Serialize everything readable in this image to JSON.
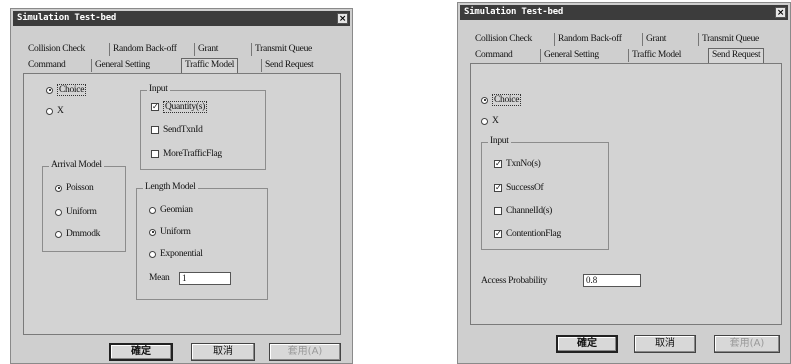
{
  "left_dialog": {
    "title": "Simulation Test-bed",
    "close_glyph": "×",
    "tabs_row1": [
      "Collision Check",
      "Random Back-off",
      "Grant",
      "Transmit Queue"
    ],
    "tabs_row2": [
      "Command",
      "General Setting",
      "Traffic Model",
      "Send Request"
    ],
    "active_tab": "Traffic Model",
    "top_radios": [
      {
        "label": "Choice",
        "checked": true
      },
      {
        "label": "X",
        "checked": false
      }
    ],
    "input_group": {
      "title": "Input",
      "items": [
        {
          "label": "Quantity(s)",
          "checked": true
        },
        {
          "label": "SendTxnId",
          "checked": false
        },
        {
          "label": "MoreTrafficFlag",
          "checked": false
        }
      ]
    },
    "arrival_group": {
      "title": "Arrival Model",
      "items": [
        {
          "label": "Poisson",
          "checked": true
        },
        {
          "label": "Uniform",
          "checked": false
        },
        {
          "label": "Dmmodk",
          "checked": false
        }
      ]
    },
    "length_group": {
      "title": "Length Model",
      "items": [
        {
          "label": "Geomian",
          "checked": false
        },
        {
          "label": "Uniform",
          "checked": true
        },
        {
          "label": "Exponential",
          "checked": false
        }
      ],
      "mean_label": "Mean",
      "mean_value": "1"
    },
    "buttons": {
      "ok": "確定",
      "cancel": "取消",
      "apply": "套用(A)"
    }
  },
  "right_dialog": {
    "title": "Simulation Test-bed",
    "close_glyph": "×",
    "tabs_row1": [
      "Collision Check",
      "Random Back-off",
      "Grant",
      "Transmit Queue"
    ],
    "tabs_row2": [
      "Command",
      "General Setting",
      "Traffic Model",
      "Send Request"
    ],
    "active_tab": "Send Request",
    "top_radios": [
      {
        "label": "Choice",
        "checked": true
      },
      {
        "label": "X",
        "checked": false
      }
    ],
    "input_group": {
      "title": "Input",
      "items": [
        {
          "label": "TxnNo(s)",
          "checked": true
        },
        {
          "label": "SuccessOf",
          "checked": true
        },
        {
          "label": "ChannelId(s)",
          "checked": false
        },
        {
          "label": "ContentionFlag",
          "checked": true
        }
      ]
    },
    "access_label": "Access Probability",
    "access_value": "0.8",
    "buttons": {
      "ok": "確定",
      "cancel": "取消",
      "apply": "套用(A)"
    }
  }
}
